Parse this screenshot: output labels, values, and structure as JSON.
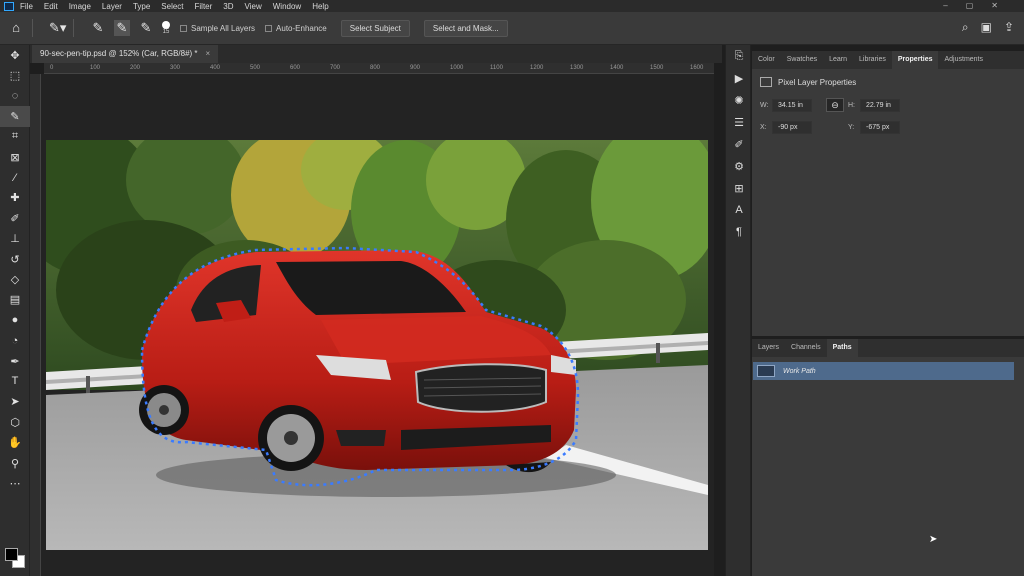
{
  "menubar": {
    "items": [
      "File",
      "Edit",
      "Image",
      "Layer",
      "Type",
      "Select",
      "Filter",
      "3D",
      "View",
      "Window",
      "Help"
    ]
  },
  "options": {
    "brush_size": "15",
    "sample_all_layers": "Sample All Layers",
    "auto_enhance": "Auto-Enhance",
    "select_subject": "Select Subject",
    "select_and_mask": "Select and Mask..."
  },
  "document": {
    "tab_title": "90-sec-pen-tip.psd @ 152% (Car, RGB/8#) *"
  },
  "ruler": {
    "marks": [
      "0",
      "100",
      "200",
      "300",
      "400",
      "500",
      "600",
      "700",
      "800",
      "900",
      "1000",
      "1100",
      "1200",
      "1300",
      "1400",
      "1500",
      "1600"
    ]
  },
  "properties_panel": {
    "tabs": [
      "Color",
      "Swatches",
      "Learn",
      "Libraries",
      "Properties",
      "Adjustments"
    ],
    "active_tab": "Properties",
    "heading": "Pixel Layer Properties",
    "w_label": "W:",
    "w_value": "34.15 in",
    "h_label": "H:",
    "h_value": "22.79 in",
    "x_label": "X:",
    "x_value": "-90 px",
    "y_label": "Y:",
    "y_value": "-675 px"
  },
  "layers_panel": {
    "tabs": [
      "Layers",
      "Channels",
      "Paths"
    ],
    "active_tab": "Paths",
    "paths": [
      {
        "name": "Work Path"
      }
    ]
  },
  "colors": {
    "accent": "#4e6a8c",
    "car": "#c4221a",
    "path": "#3a7bff"
  }
}
